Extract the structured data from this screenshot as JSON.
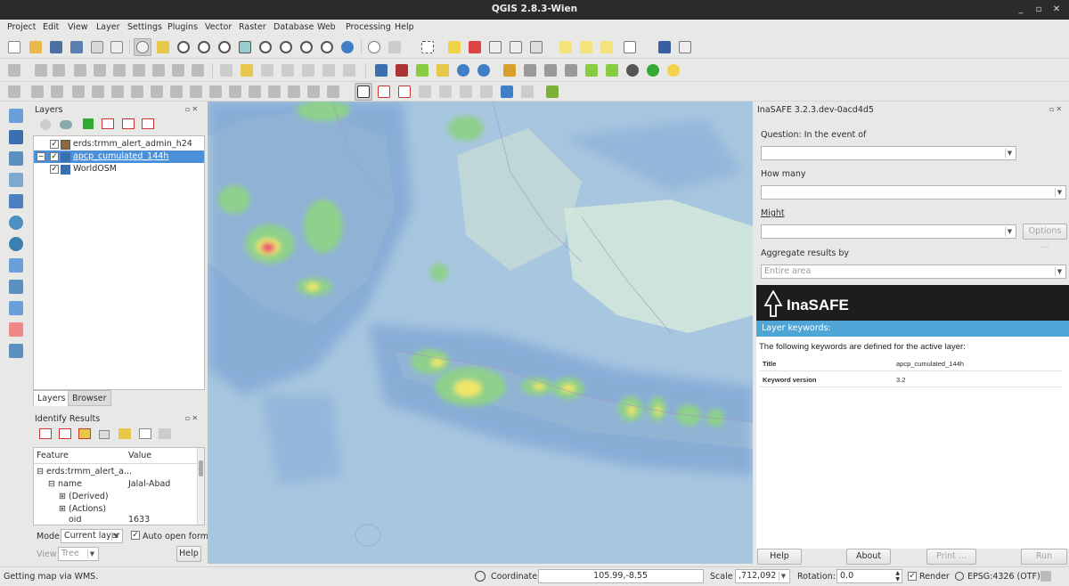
{
  "window": {
    "title": "QGIS 2.8.3-Wien"
  },
  "menu": [
    "Project",
    "Edit",
    "View",
    "Layer",
    "Settings",
    "Plugins",
    "Vector",
    "Raster",
    "Database",
    "Web",
    "Processing",
    "Help"
  ],
  "layers_panel": {
    "title": "Layers",
    "layers": [
      {
        "name": "erds:trmm_alert_admin_h24",
        "checked": true,
        "selected": false,
        "icon": "polygon-layer-icon"
      },
      {
        "name": "apcp_cumulated_144h",
        "checked": true,
        "selected": true,
        "icon": "raster-layer-icon"
      },
      {
        "name": "WorldOSM",
        "checked": true,
        "selected": false,
        "icon": "wms-layer-icon"
      }
    ],
    "tabs": [
      "Layers",
      "Browser"
    ]
  },
  "identify_panel": {
    "title": "Identify Results",
    "columns": [
      "Feature",
      "Value"
    ],
    "rows": [
      {
        "feature": "erds:trmm_alert_a...",
        "value": ""
      },
      {
        "feature": "name",
        "value": "Jalal-Abad"
      },
      {
        "feature": "(Derived)",
        "value": ""
      },
      {
        "feature": "(Actions)",
        "value": ""
      },
      {
        "feature": "oid",
        "value": "1633"
      }
    ],
    "mode_label": "Mode",
    "mode_value": "Current layer",
    "auto_open_label": "Auto open form",
    "auto_open_checked": true,
    "view_label": "View",
    "view_value": "Tree",
    "help_label": "Help"
  },
  "inasafe": {
    "title": "InaSAFE 3.2.3.dev-0acd4d5",
    "question_label": "Question: In the event of",
    "how_many_label": "How many",
    "might_label": "Might",
    "options_label": "Options ...",
    "aggregate_label": "Aggregate results by",
    "aggregate_value": "Entire area",
    "logo_text": "InaSAFE",
    "keywords_header": "Layer keywords:",
    "keywords_desc": "The following keywords are defined for the active layer:",
    "keywords": [
      {
        "key": "Title",
        "value": "apcp_cumulated_144h"
      },
      {
        "key": "Keyword version",
        "value": "3.2"
      }
    ],
    "buttons": {
      "help": "Help",
      "about": "About",
      "print": "Print ...",
      "run": "Run"
    }
  },
  "statusbar": {
    "message": "Getting map via WMS.",
    "coordinate_label": "Coordinate:",
    "coordinate_value": "105.99,-8.55",
    "scale_label": "Scale",
    "scale_value": ",712,092",
    "rotation_label": "Rotation:",
    "rotation_value": "0.0",
    "render_label": "Render",
    "render_checked": true,
    "crs_value": "EPSG:4326 (OTF)"
  },
  "colors": {
    "selection": "#4a90d9",
    "sea": "#9ec0dc",
    "land": "#cfe3d6",
    "rain_low": "#7fa6d4",
    "rain_mid": "#8ed08c",
    "rain_high": "#f0e66a",
    "rain_peak": "#e8556e",
    "inasafe_bar": "#4fa6d6"
  }
}
